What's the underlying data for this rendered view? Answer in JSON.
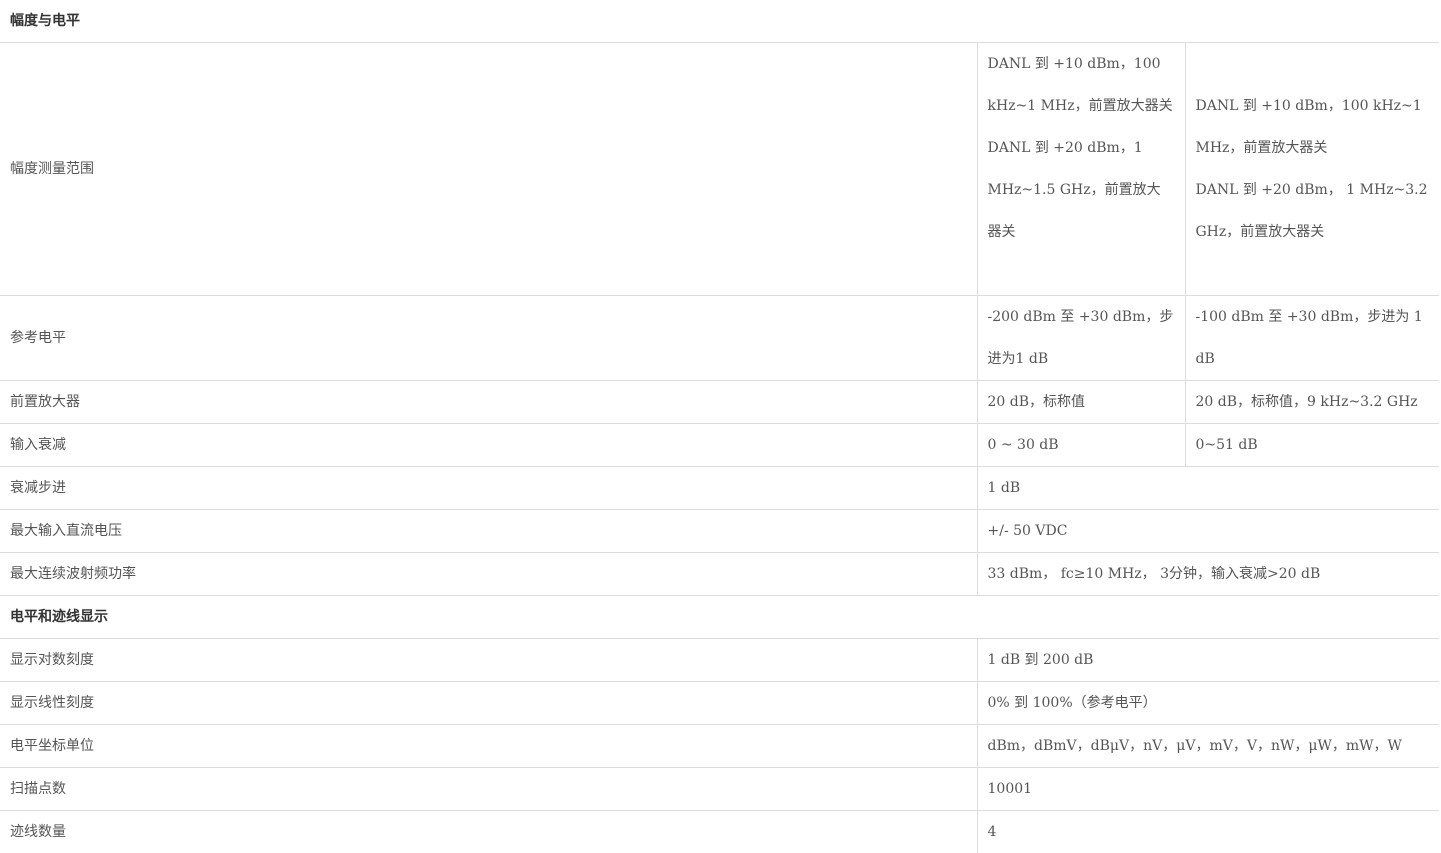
{
  "sections": [
    {
      "title": "幅度与电平",
      "rows": [
        {
          "label": "幅度测量范围",
          "col1": [
            "DANL  到 +10 dBm，100 kHz~1 MHz，前置放大器关",
            " DANL  到 +20 dBm，1 MHz~1.5 GHz，前置放大器关"
          ],
          "col2": [
            "DANL 到 +10 dBm，100 kHz~1 MHz，前置放大器关",
            "DANL 到 +20 dBm， 1 MHz~3.2 GHz，前置放大器关"
          ]
        },
        {
          "label": "参考电平",
          "col1": "-200 dBm  至 +30 dBm，步进为1 dB",
          "col2": "-100 dBm 至 +30 dBm，步进为 1 dB"
        },
        {
          "label": "前置放大器",
          "col1": "20 dB，标称值",
          "col2": "20 dB，标称值，9 kHz~3.2 GHz"
        },
        {
          "label": "输入衰减",
          "col1": "0 ~ 30 dB",
          "col2": "0~51 dB"
        },
        {
          "label": "衰减步进",
          "value": "1 dB"
        },
        {
          "label": "最大输入直流电压",
          "value": "+/- 50 VDC"
        },
        {
          "label": "最大连续波射频功率",
          "value": "33 dBm，  fc≥10 MHz，  3分钟，输入衰减>20 dB"
        }
      ]
    },
    {
      "title": "电平和迹线显示",
      "rows": [
        {
          "label": "显示对数刻度",
          "value": "1 dB  到 200 dB"
        },
        {
          "label": "显示线性刻度",
          "value": "0%  到 100%（参考电平）"
        },
        {
          "label": "电平坐标单位",
          "value": "dBm，dBmV，dBμV，nV，μV，mV，V，nW，μW，mW，W"
        },
        {
          "label": "扫描点数",
          "value": "10001"
        },
        {
          "label": "迹线数量",
          "value": "4"
        }
      ]
    }
  ]
}
